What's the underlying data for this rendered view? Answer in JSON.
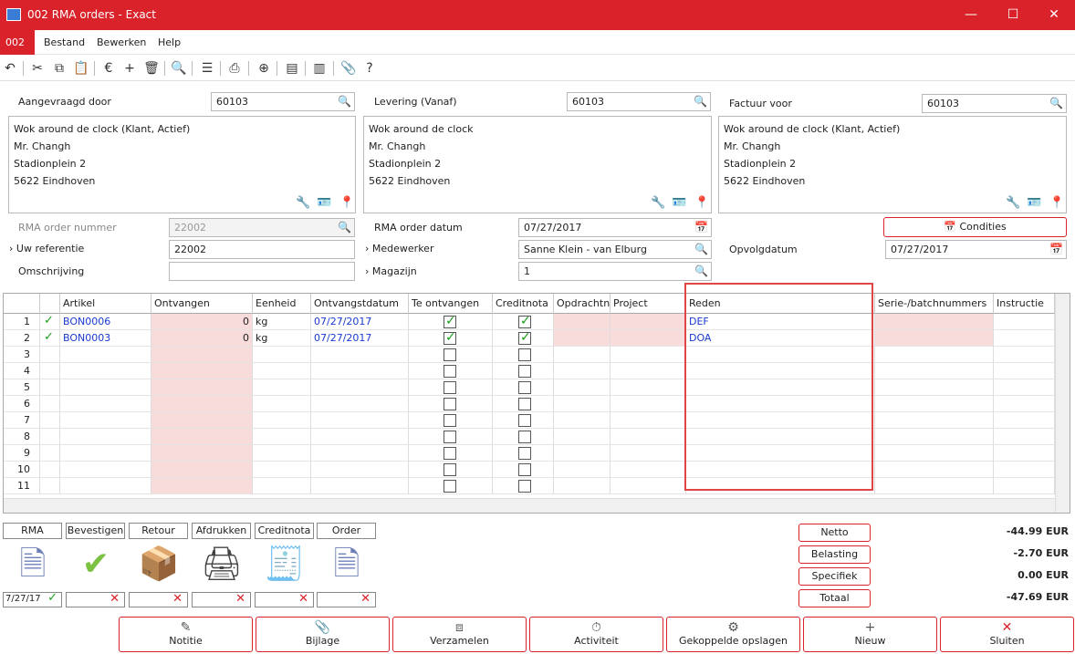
{
  "window": {
    "title": "002 RMA orders - Exact",
    "minimize": "—",
    "maximize": "☐",
    "close": "✕"
  },
  "menu": {
    "code": "002",
    "items": [
      "Bestand",
      "Bewerken",
      "Help"
    ]
  },
  "toolbar": {
    "icons": [
      "undo-icon",
      "cut-icon",
      "copy-icon",
      "paste-icon",
      "currency-icon",
      "add-icon",
      "delete-icon",
      "preview-icon",
      "list-icon",
      "print-icon",
      "zoom-icon",
      "note-icon",
      "notes-icon",
      "attach-icon",
      "help-icon"
    ]
  },
  "header": {
    "requested_by": {
      "label": "Aangevraagd door",
      "value": "60103"
    },
    "delivery": {
      "label": "Levering (Vanaf)",
      "value": "60103"
    },
    "invoice": {
      "label": "Factuur voor",
      "value": "60103"
    },
    "address": [
      "Wok around de clock (Klant, Actief)",
      "Mr. Changh",
      "Stadionplein 2",
      "5622  Eindhoven"
    ],
    "address_delivery": [
      "Wok around de clock",
      "Mr. Changh",
      "Stadionplein 2",
      "5622  Eindhoven"
    ],
    "address_invoice": [
      "Wok around de clock (Klant, Actief)",
      "Mr. Changh",
      "Stadionplein 2",
      "5622  Eindhoven"
    ],
    "rma_number": {
      "label": "RMA order nummer",
      "value": "22002"
    },
    "your_ref": {
      "label": "Uw referentie",
      "value": "22002"
    },
    "description": {
      "label": "Omschrijving",
      "value": ""
    },
    "rma_date": {
      "label": "RMA order datum",
      "value": "07/27/2017"
    },
    "employee": {
      "label": "Medewerker",
      "value": "Sanne Klein - van Elburg"
    },
    "warehouse": {
      "label": "Magazijn",
      "value": "1"
    },
    "conditions_label": "Condities",
    "followup": {
      "label": "Opvolgdatum",
      "value": "07/27/2017"
    }
  },
  "grid": {
    "columns": [
      "Artikel",
      "Ontvangen",
      "Eenheid",
      "Ontvangstdatum",
      "Te ontvangen",
      "Creditnota",
      "Opdrachtnu",
      "Project",
      "Reden",
      "Serie-/batchnummers",
      "Instructie"
    ],
    "rows": [
      {
        "n": "1",
        "ok": true,
        "artikel": "BON0006",
        "ontvangen": "0",
        "eenheid": "kg",
        "datum": "07/27/2017",
        "te": true,
        "credit": true,
        "reden": "DEF"
      },
      {
        "n": "2",
        "ok": true,
        "artikel": "BON0003",
        "ontvangen": "0",
        "eenheid": "kg",
        "datum": "07/27/2017",
        "te": true,
        "credit": true,
        "reden": "DOA"
      },
      {
        "n": "3"
      },
      {
        "n": "4"
      },
      {
        "n": "5"
      },
      {
        "n": "6"
      },
      {
        "n": "7"
      },
      {
        "n": "8"
      },
      {
        "n": "9"
      },
      {
        "n": "10"
      },
      {
        "n": "11"
      }
    ]
  },
  "states": [
    {
      "label": "RMA",
      "value": "7/27/17",
      "done": true
    },
    {
      "label": "Bevestigen",
      "value": "",
      "done": false
    },
    {
      "label": "Retour",
      "value": "",
      "done": false
    },
    {
      "label": "Afdrukken",
      "value": "",
      "done": false
    },
    {
      "label": "Creditnota",
      "value": "",
      "done": false
    },
    {
      "label": "Order",
      "value": "",
      "done": false
    }
  ],
  "totals": [
    {
      "label": "Netto",
      "value": "-44.99 EUR"
    },
    {
      "label": "Belasting",
      "value": "-2.70 EUR"
    },
    {
      "label": "Specifiek",
      "value": "0.00 EUR"
    },
    {
      "label": "Totaal",
      "value": "-47.69 EUR"
    }
  ],
  "actions": [
    {
      "label": "Notitie",
      "icon": "note-icon"
    },
    {
      "label": "Bijlage",
      "icon": "paperclip-icon"
    },
    {
      "label": "Verzamelen",
      "icon": "collect-icon"
    },
    {
      "label": "Activiteit",
      "icon": "stopwatch-icon"
    },
    {
      "label": "Gekoppelde opslagen",
      "icon": "linked-icon"
    },
    {
      "label": "Nieuw",
      "icon": "plus-icon"
    },
    {
      "label": "Sluiten",
      "icon": "close-icon"
    }
  ]
}
